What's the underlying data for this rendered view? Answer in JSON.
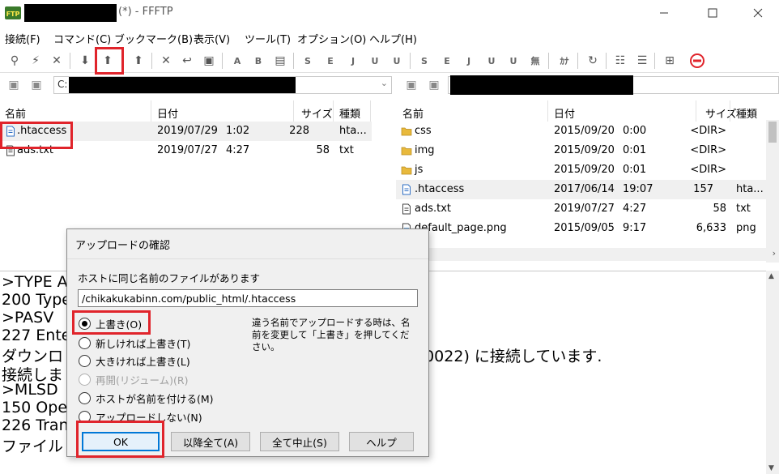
{
  "window": {
    "title_suffix": "(*) - FFFTP",
    "app_icon_label": "FTP",
    "controls": [
      "minimize-icon",
      "maximize-icon",
      "close-icon"
    ]
  },
  "menu": [
    "接続(F)",
    "コマンド(C)",
    "ブックマーク(B)",
    "表示(V)",
    "ツール(T)",
    "オプション(O)",
    "ヘルプ(H)"
  ],
  "toolbar": {
    "text_buttons": [
      "A",
      "B",
      "S",
      "E",
      "J",
      "U",
      "U",
      "S",
      "E",
      "J",
      "U",
      "U",
      "無",
      "ｶﾅ"
    ]
  },
  "local": {
    "path": "C:",
    "columns": [
      "名前",
      "日付",
      "サイズ",
      "種類"
    ],
    "files": [
      {
        "name": ".htaccess",
        "date": "2019/07/29",
        "time": "1:02",
        "size": "228",
        "type": "hta...",
        "icon": "file-icon"
      },
      {
        "name": "ads.txt",
        "date": "2019/07/27",
        "time": "4:27",
        "size": "58",
        "type": "txt",
        "icon": "text-file-icon"
      }
    ]
  },
  "remote": {
    "columns": [
      "名前",
      "日付",
      "サイズ",
      "種類"
    ],
    "files": [
      {
        "name": "css",
        "date": "2015/09/20",
        "time": "0:00",
        "size": "<DIR>",
        "type": "",
        "icon": "folder-icon"
      },
      {
        "name": "img",
        "date": "2015/09/20",
        "time": "0:01",
        "size": "<DIR>",
        "type": "",
        "icon": "folder-icon"
      },
      {
        "name": "js",
        "date": "2015/09/20",
        "time": "0:01",
        "size": "<DIR>",
        "type": "",
        "icon": "folder-icon"
      },
      {
        "name": ".htaccess",
        "date": "2017/06/14",
        "time": "19:07",
        "size": "157",
        "type": "hta...",
        "icon": "file-icon"
      },
      {
        "name": "ads.txt",
        "date": "2019/07/27",
        "time": "4:27",
        "size": "58",
        "type": "txt",
        "icon": "text-file-icon"
      },
      {
        "name": "default_page.png",
        "date": "2015/09/05",
        "time": "9:17",
        "size": "6,633",
        "type": "png",
        "icon": "image-file-icon"
      }
    ]
  },
  "log": {
    "lines": [
      ">TYPE A",
      "200 Type",
      ">PASV",
      "227 Enter",
      "ダウンロ",
      "接続しま",
      ">MLSD",
      "150 Open",
      "226 Trans",
      "ファイル"
    ],
    "fragment": "60022) に接続しています."
  },
  "dialog": {
    "title": "アップロードの確認",
    "message": "ホストに同じ名前のファイルがあります",
    "filename": "/chikakukabinn.com/public_html/.htaccess",
    "note": "違う名前でアップロードする時は、名前を変更して「上書き」を押してください。",
    "options": [
      {
        "label": "上書き(O)",
        "selected": true,
        "enabled": true
      },
      {
        "label": "新しければ上書き(T)",
        "selected": false,
        "enabled": true
      },
      {
        "label": "大きければ上書き(L)",
        "selected": false,
        "enabled": true
      },
      {
        "label": "再開(リジューム)(R)",
        "selected": false,
        "enabled": false
      },
      {
        "label": "ホストが名前を付ける(M)",
        "selected": false,
        "enabled": true
      },
      {
        "label": "アップロードしない(N)",
        "selected": false,
        "enabled": true
      }
    ],
    "buttons": {
      "ok": "OK",
      "all": "以降全て(A)",
      "abort": "全て中止(S)",
      "help": "ヘルプ"
    }
  },
  "colors": {
    "highlight": "#e0242b",
    "folder": "#e8b93c",
    "file": "#2f6fc4",
    "selection": "#f0f0f0"
  }
}
